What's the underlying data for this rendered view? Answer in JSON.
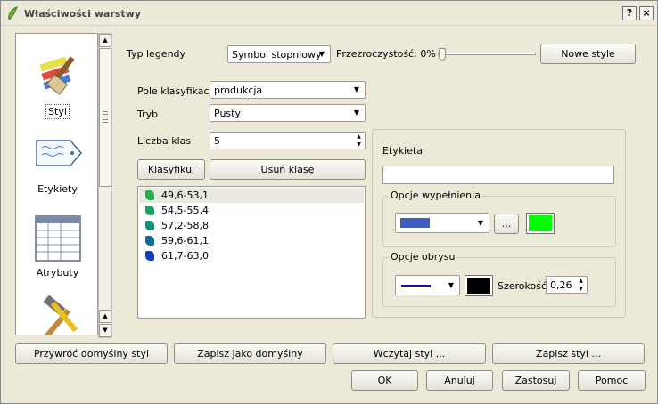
{
  "window": {
    "title": "Właściwości warstwy",
    "help_label": "?",
    "close_label": "×"
  },
  "sidebar": {
    "items": [
      {
        "label": "Styl",
        "icon": "brush-icon"
      },
      {
        "label": "Etykiety",
        "icon": "label-tag-icon"
      },
      {
        "label": "Atrybuty",
        "icon": "table-icon"
      },
      {
        "label": "",
        "icon": "tools-icon"
      }
    ]
  },
  "style": {
    "legend_type_label": "Typ legendy",
    "legend_type_value": "Symbol stopniowy",
    "transparency_label": "Przezroczystość: 0%",
    "transparency_value": 0,
    "new_style_button": "Nowe style",
    "class_field_label": "Pole klasyfikacji",
    "class_field_value": "produkcja",
    "mode_label": "Tryb",
    "mode_value": "Pusty",
    "class_count_label": "Liczba klas",
    "class_count_value": "5",
    "classify_button": "Klasyfikuj",
    "remove_class_button": "Usuń klasę",
    "classes": [
      {
        "label": "49,6-53,1",
        "color": "#22b04a"
      },
      {
        "label": "54,5-55,4",
        "color": "#18a05e"
      },
      {
        "label": "57,2-58,8",
        "color": "#129078"
      },
      {
        "label": "59,6-61,1",
        "color": "#106a9c"
      },
      {
        "label": "61,7-63,0",
        "color": "#1040b8"
      }
    ]
  },
  "symbol": {
    "label_title": "Etykieta",
    "label_value": "",
    "fill_group": "Opcje wypełnienia",
    "fill_style_color": "#3d5fc4",
    "fill_more_button": "...",
    "fill_color": "#00ff00",
    "stroke_group": "Opcje obrysu",
    "stroke_style_color": "#1010a0",
    "stroke_color": "#000000",
    "width_label": "Szerokość",
    "width_value": "0,26"
  },
  "footer": {
    "restore_default": "Przywróć domyślny styl",
    "save_default": "Zapisz jako domyślny",
    "load_style": "Wczytaj styl ...",
    "save_style": "Zapisz styl ...",
    "ok": "OK",
    "cancel": "Anuluj",
    "apply": "Zastosuj",
    "help": "Pomoc"
  }
}
